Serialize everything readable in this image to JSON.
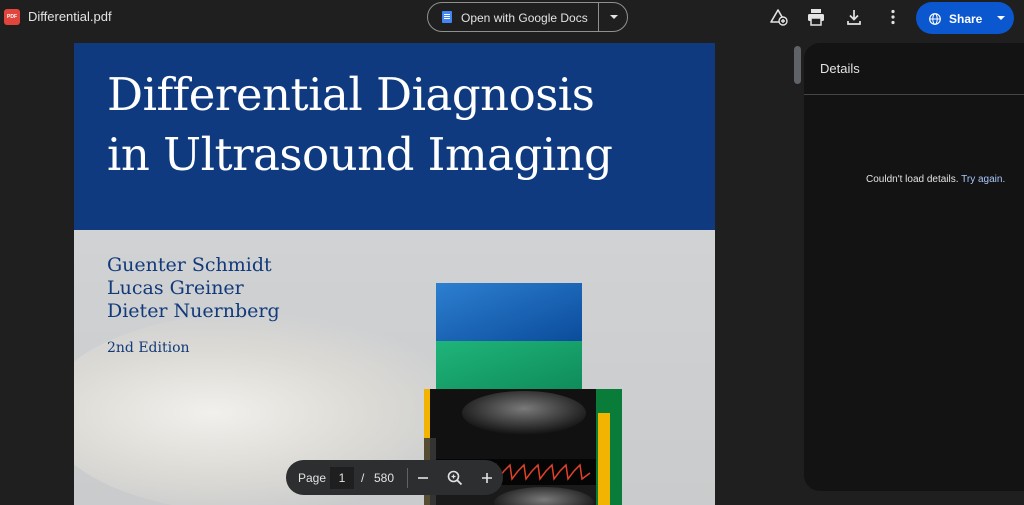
{
  "header": {
    "file_badge": "PDF",
    "file_name": "Differential.pdf",
    "open_with_label": "Open with Google Docs",
    "share_label": "Share",
    "icons": [
      "add-to-drive-icon",
      "print-icon",
      "download-icon",
      "more-vert-icon",
      "globe-icon"
    ]
  },
  "document": {
    "title_line1": "Differential Diagnosis",
    "title_line2": "in Ultrasound Imaging",
    "authors": [
      "Guenter Schmidt",
      "Lucas Greiner",
      "Dieter Nuernberg"
    ],
    "edition": "2nd Edition"
  },
  "page_controls": {
    "page_label": "Page",
    "current_page": "1",
    "separator": "/",
    "total_pages": "580"
  },
  "details_panel": {
    "title": "Details",
    "message": "Couldn't load details.",
    "retry_link": "Try again."
  },
  "colors": {
    "background": "#1f1f1f",
    "cover_blue": "#0f3a80",
    "share_blue": "#0b57d0",
    "link": "#a8c7fa"
  }
}
